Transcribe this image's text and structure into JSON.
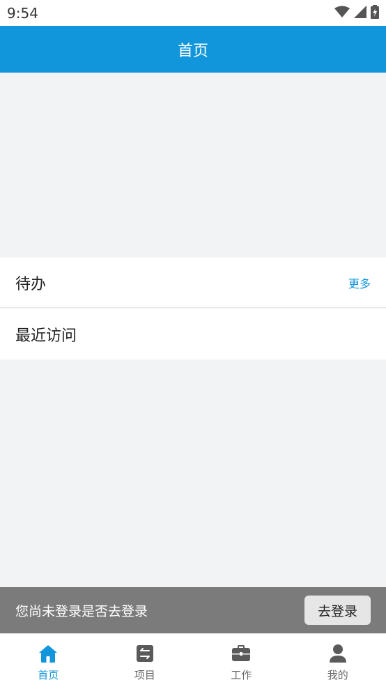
{
  "status_bar": {
    "time": "9:54"
  },
  "app_bar": {
    "title": "首页"
  },
  "sections": {
    "todo_label": "待办",
    "todo_more": "更多",
    "recent_label": "最近访问"
  },
  "login_prompt": {
    "message": "您尚未登录是否去登录",
    "button_label": "去登录"
  },
  "tabs": [
    {
      "label": "首页",
      "icon": "home-icon",
      "active": true
    },
    {
      "label": "项目",
      "icon": "swap-icon",
      "active": false
    },
    {
      "label": "工作",
      "icon": "briefcase-icon",
      "active": false
    },
    {
      "label": "我的",
      "icon": "person-icon",
      "active": false
    }
  ],
  "colors": {
    "primary": "#1296db",
    "background": "#f2f3f5",
    "login_bar": "#7b7b7b",
    "inactive_icon": "#5a5a5a"
  }
}
